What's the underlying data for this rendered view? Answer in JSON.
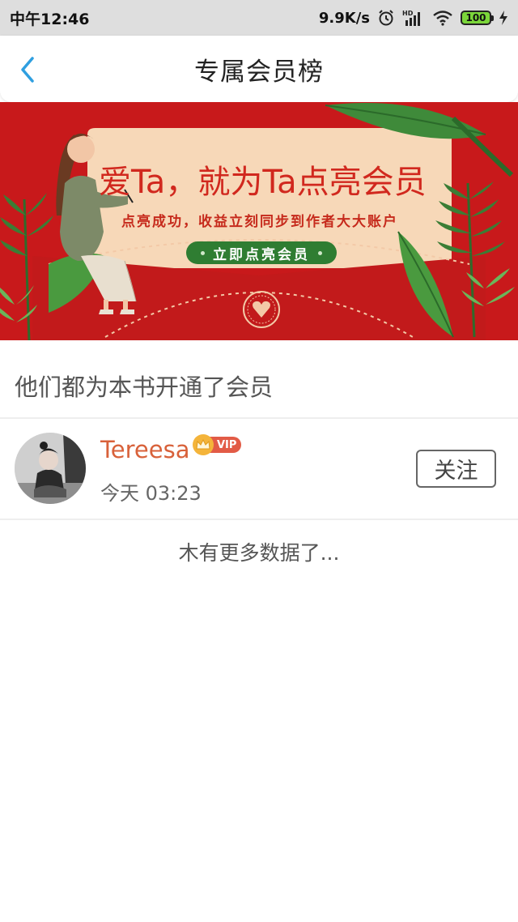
{
  "status_bar": {
    "time": "中午12:46",
    "network_speed": "9.9K/s",
    "network_type": "HD",
    "battery": "100",
    "icons": [
      "alarm-icon",
      "signal-icon",
      "wifi-icon",
      "battery-icon",
      "charging-icon"
    ]
  },
  "nav": {
    "title": "专属会员榜",
    "back_icon": "chevron-left-icon",
    "accent_color": "#2f9fe0"
  },
  "banner": {
    "headline": "爱Ta，就为Ta点亮会员",
    "subtitle": "点亮成功，收益立刻同步到作者大大账户",
    "button_label": "立即点亮会员",
    "colors": {
      "background": "#c8191b",
      "card": "#f7d8b8",
      "button": "#2f7d32",
      "text": "#d1281e"
    }
  },
  "section": {
    "title": "他们都为本书开通了会员"
  },
  "members": [
    {
      "name": "Tereesa",
      "badge": "VIP",
      "time": "今天 03:23",
      "follow_label": "关注"
    }
  ],
  "footer": {
    "no_more_text": "木有更多数据了..."
  }
}
